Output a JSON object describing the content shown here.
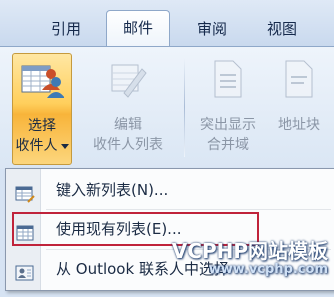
{
  "tabs": [
    {
      "label": "引用",
      "active": false
    },
    {
      "label": "邮件",
      "active": true
    },
    {
      "label": "审阅",
      "active": false
    },
    {
      "label": "视图",
      "active": false
    }
  ],
  "ribbon": {
    "select_recipients": {
      "line1": "选择",
      "line2": "收件人",
      "has_dropdown": true,
      "state": "pressed"
    },
    "edit_recipients": {
      "line1": "编辑",
      "line2": "收件人列表",
      "state": "disabled"
    },
    "highlight_fields": {
      "line1": "突出显示",
      "line2": "合并域",
      "state": "disabled"
    },
    "address_block": {
      "line1": "地址块",
      "state": "disabled"
    }
  },
  "menu": {
    "items": [
      {
        "label": "键入新列表(N)...",
        "icon": "new-list-icon",
        "highlighted": false
      },
      {
        "label": "使用现有列表(E)...",
        "icon": "existing-list-icon",
        "highlighted": true
      },
      {
        "label": "从 Outlook 联系人中选择",
        "icon": "outlook-contacts-icon",
        "highlighted": false
      }
    ]
  },
  "watermark": {
    "line1": "VCPHP网站模板",
    "line2": "www.vcphp.com"
  },
  "colors": {
    "accent_pressed": "#ffcf5c",
    "highlight_box": "#c0233b",
    "ribbon_bg": "#e4edf8"
  }
}
